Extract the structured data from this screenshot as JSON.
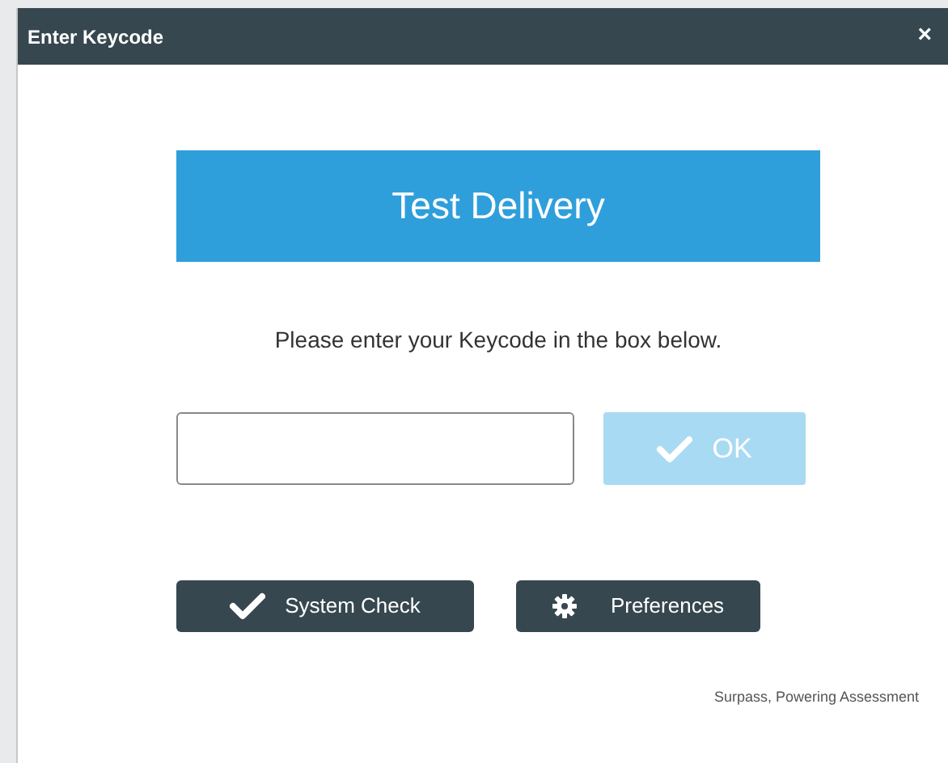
{
  "window": {
    "title": "Enter Keycode",
    "close": "×"
  },
  "banner": "Test Delivery",
  "instruction": "Please enter your Keycode in the box below.",
  "ok_button": {
    "label": "OK",
    "disabled": true
  },
  "actions": [
    {
      "label": "System Check",
      "kind": "check"
    },
    {
      "label": "Preferences",
      "kind": "gear"
    }
  ],
  "footer": "Surpass, Powering Assessment"
}
